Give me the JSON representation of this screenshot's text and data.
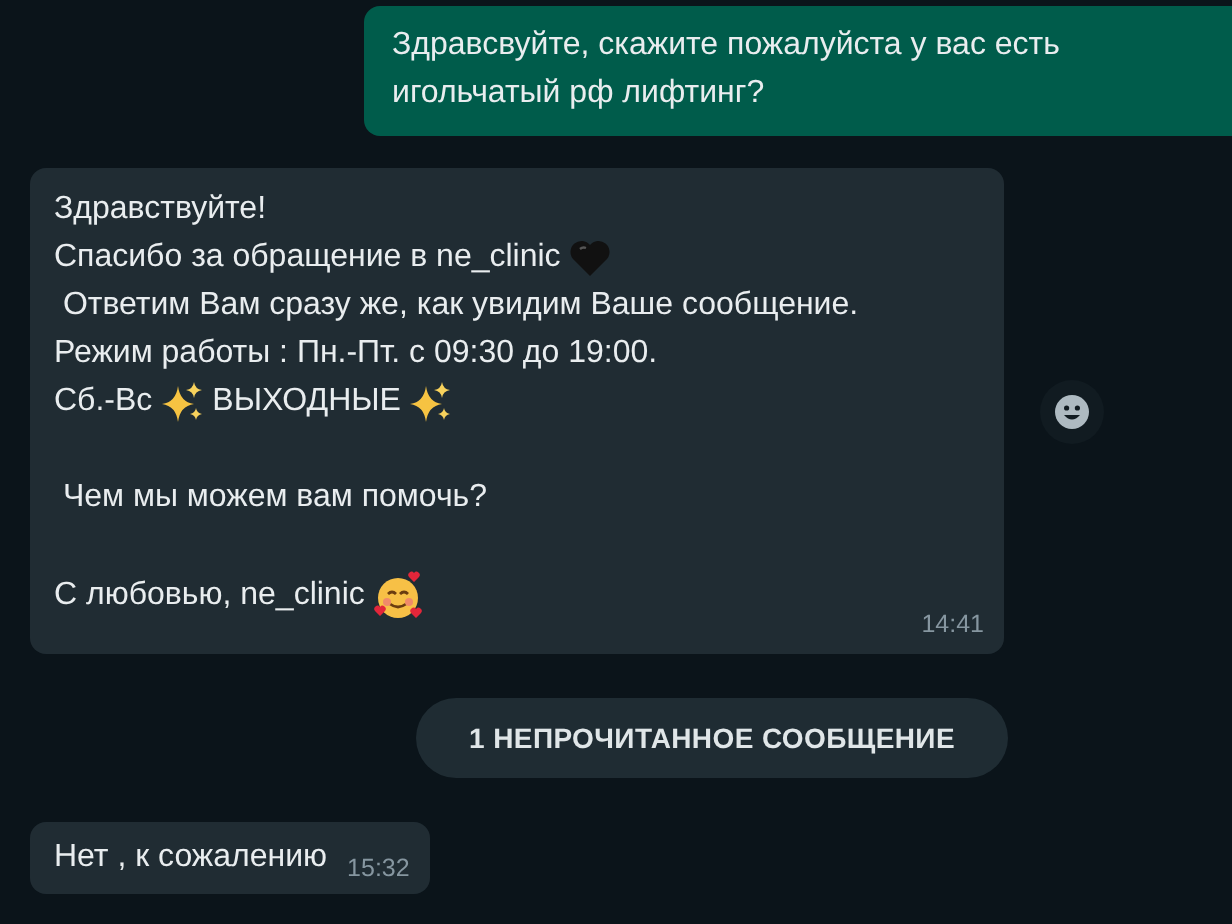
{
  "messages": [
    {
      "kind": "outgoing",
      "paragraphs": [
        [
          [
            {
              "kind": "text",
              "text": "Здравсвуйте, скажите пожалуйста у вас есть"
            }
          ],
          [
            {
              "kind": "text",
              "text": "игольчатый рф лифтинг?"
            }
          ]
        ]
      ]
    },
    {
      "kind": "incoming",
      "time": "14:41",
      "reaction_button": true,
      "paragraphs": [
        [
          [
            {
              "kind": "text",
              "text": "Здравствуйте!"
            }
          ],
          [
            {
              "kind": "text",
              "text": "Спасибо за обращение в ne_clinic"
            },
            {
              "kind": "heart"
            }
          ],
          [
            {
              "kind": "text",
              "text": " Ответим Вам сразу же, как увидим Ваше сообщение."
            }
          ],
          [
            {
              "kind": "text",
              "text": "Режим работы : Пн.-Пт. с 09:30 до 19:00."
            }
          ],
          [
            {
              "kind": "text",
              "text": "Сб.-Вс"
            },
            {
              "kind": "sparkles"
            },
            {
              "kind": "text",
              "text": "ВЫХОДНЫЕ"
            },
            {
              "kind": "sparkles"
            }
          ]
        ],
        [
          [
            {
              "kind": "text",
              "text": " Чем мы можем вам помочь?"
            }
          ]
        ],
        [
          [
            {
              "kind": "text",
              "text": "С любовью, ne_clinic"
            },
            {
              "kind": "smiling-hearts"
            }
          ]
        ]
      ]
    },
    {
      "kind": "divider",
      "text": "1 НЕПРОЧИТАННОЕ СООБЩЕНИЕ"
    },
    {
      "kind": "incoming",
      "time": "15:32",
      "paragraphs": [
        [
          [
            {
              "kind": "text",
              "text": "Нет , к сожалению"
            }
          ]
        ]
      ]
    }
  ]
}
